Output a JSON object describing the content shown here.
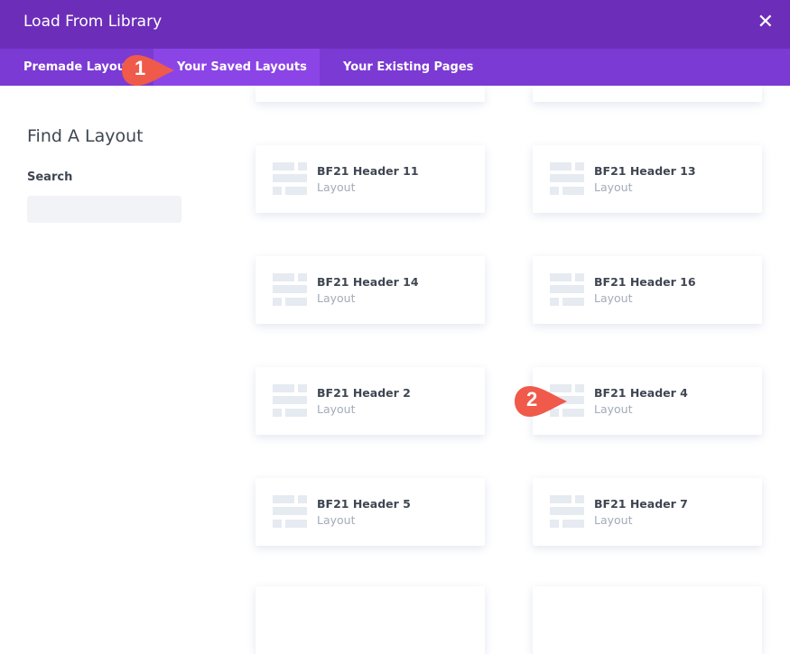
{
  "header": {
    "title": "Load From Library",
    "close_icon": "close-icon"
  },
  "tabs": [
    {
      "label": "Premade Layouts"
    },
    {
      "label": "Your Saved Layouts",
      "active": true
    },
    {
      "label": "Your Existing Pages"
    }
  ],
  "sidebar": {
    "title": "Find A Layout",
    "search_label": "Search",
    "search_value": ""
  },
  "cards": [
    {
      "name": "BF21 Header 11",
      "type": "Layout"
    },
    {
      "name": "BF21 Header 13",
      "type": "Layout"
    },
    {
      "name": "BF21 Header 14",
      "type": "Layout"
    },
    {
      "name": "BF21 Header 16",
      "type": "Layout"
    },
    {
      "name": "BF21 Header 2",
      "type": "Layout"
    },
    {
      "name": "BF21 Header 4",
      "type": "Layout"
    },
    {
      "name": "BF21 Header 5",
      "type": "Layout"
    },
    {
      "name": "BF21 Header 7",
      "type": "Layout"
    }
  ],
  "markers": [
    "1",
    "2"
  ],
  "colors": {
    "header": "#6c2eb9",
    "tabbar": "#7b3ad3",
    "active_tab": "#8b45e6",
    "marker": "#ef5a4a"
  }
}
